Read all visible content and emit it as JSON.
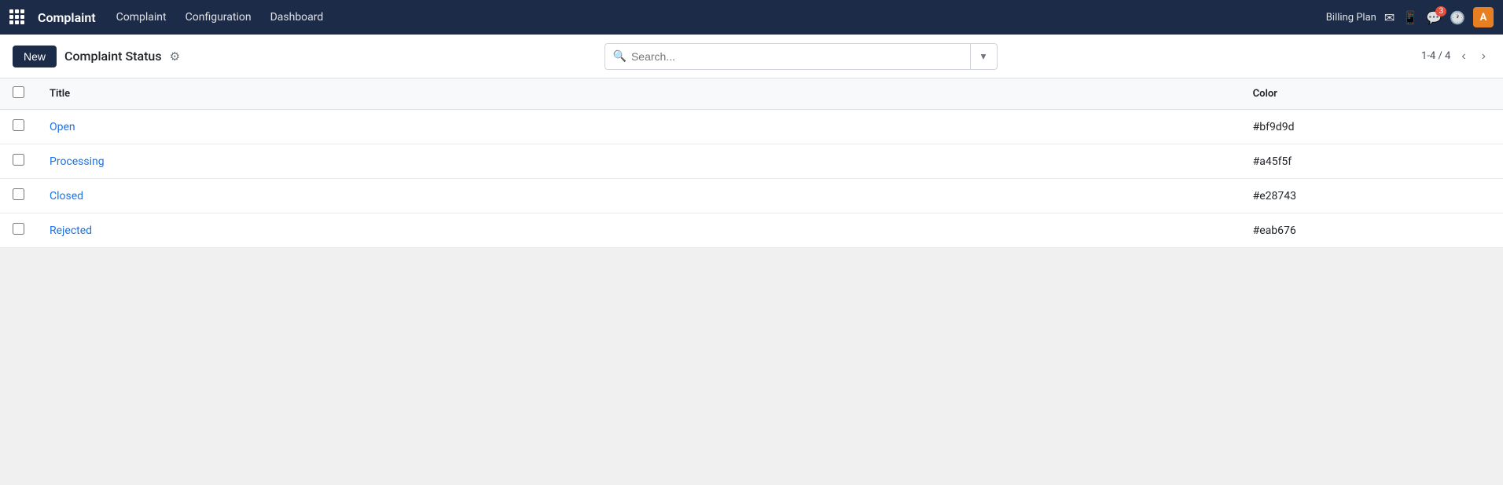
{
  "navbar": {
    "app_title": "Complaint",
    "menu_items": [
      {
        "label": "Complaint",
        "id": "complaint"
      },
      {
        "label": "Configuration",
        "id": "configuration"
      },
      {
        "label": "Dashboard",
        "id": "dashboard"
      }
    ],
    "billing_plan_label": "Billing Plan",
    "message_count": "3",
    "avatar_letter": "A"
  },
  "toolbar": {
    "new_button_label": "New",
    "page_title": "Complaint Status",
    "search_placeholder": "Search...",
    "pagination": "1-4 / 4"
  },
  "table": {
    "columns": [
      {
        "id": "title",
        "label": "Title"
      },
      {
        "id": "color",
        "label": "Color"
      }
    ],
    "rows": [
      {
        "title": "Open",
        "color": "#bf9d9d"
      },
      {
        "title": "Processing",
        "color": "#a45f5f"
      },
      {
        "title": "Closed",
        "color": "#e28743"
      },
      {
        "title": "Rejected",
        "color": "#eab676"
      }
    ]
  }
}
